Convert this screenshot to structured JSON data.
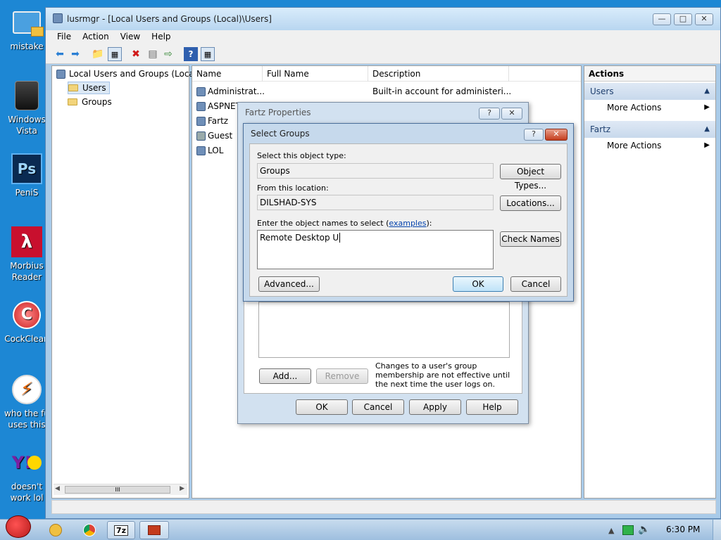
{
  "desktop": {
    "icons": [
      {
        "label": "mistake",
        "icon": "computer-folder-icon"
      },
      {
        "label": "Windows Vista",
        "icon": "trash-bin-icon"
      },
      {
        "label": "PeniS",
        "icon": "photoshop-icon",
        "glyph": "Ps"
      },
      {
        "label": "Morbius Reader",
        "icon": "pdf-reader-icon"
      },
      {
        "label": "CockClean",
        "icon": "ccleaner-icon"
      },
      {
        "label": "who the fu uses this",
        "icon": "winamp-icon"
      },
      {
        "label": "doesn't work lol",
        "icon": "yahoo-messenger-icon",
        "glyph": "Y!"
      }
    ]
  },
  "window": {
    "title": "lusrmgr - [Local Users and Groups (Local)\\Users]",
    "menu": [
      "File",
      "Action",
      "View",
      "Help"
    ],
    "tree": {
      "root": "Local Users and Groups (Loca",
      "items": [
        "Users",
        "Groups"
      ],
      "scroll_label": "III"
    },
    "list": {
      "columns": [
        "Name",
        "Full Name",
        "Description"
      ],
      "rows": [
        {
          "name": "Administrat...",
          "full_name": "",
          "description": "Built-in account for administeri..."
        },
        {
          "name": "ASPNET",
          "full_name": "",
          "description": ""
        },
        {
          "name": "Fartz",
          "full_name": "",
          "description": ""
        },
        {
          "name": "Guest",
          "full_name": "",
          "description": ""
        },
        {
          "name": "LOL",
          "full_name": "",
          "description": ""
        }
      ]
    },
    "actions": {
      "title": "Actions",
      "sections": [
        {
          "header": "Users",
          "item": "More Actions"
        },
        {
          "header": "Fartz",
          "item": "More Actions"
        }
      ]
    }
  },
  "properties_dialog": {
    "title": "Fartz Properties",
    "add_label": "Add...",
    "remove_label": "Remove",
    "note": "Changes to a user's group membership are not effective until the next time the user logs on.",
    "buttons": [
      "OK",
      "Cancel",
      "Apply",
      "Help"
    ]
  },
  "select_dialog": {
    "title": "Select Groups",
    "object_type_label": "Select this object type:",
    "object_type_value": "Groups",
    "object_types_button": "Object Types...",
    "location_label": "From this location:",
    "location_value": "DILSHAD-SYS",
    "locations_button": "Locations...",
    "names_label_prefix": "Enter the object names to select (",
    "names_label_link": "examples",
    "names_label_suffix": "):",
    "names_value": "Remote Desktop U",
    "check_names_button": "Check Names",
    "advanced_button": "Advanced...",
    "ok_button": "OK",
    "cancel_button": "Cancel"
  },
  "taskbar": {
    "time": "6:30 PM",
    "tasks": [
      "7z"
    ]
  }
}
